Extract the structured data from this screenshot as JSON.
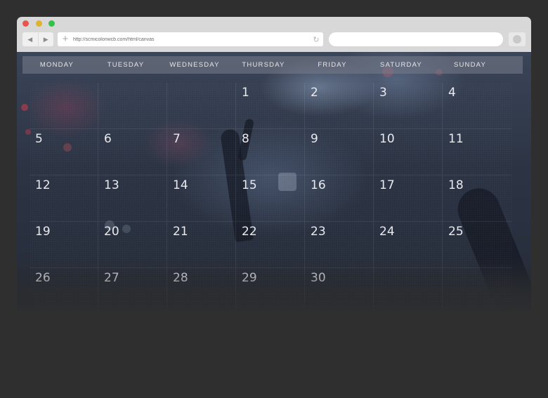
{
  "browser": {
    "url": "http://scmicolonwcb.com/html/canvas",
    "back_icon": "◀",
    "forward_icon": "▶",
    "add_icon": "+",
    "reload_icon": "↻"
  },
  "calendar": {
    "weekdays": [
      "MONDAY",
      "TUESDAY",
      "WEDNESDAY",
      "THURSDAY",
      "FRIDAY",
      "SATURDAY",
      "SUNDAY"
    ],
    "first_weekday_index": 3,
    "days": [
      "1",
      "2",
      "3",
      "4",
      "5",
      "6",
      "7",
      "8",
      "9",
      "10",
      "11",
      "12",
      "13",
      "14",
      "15",
      "16",
      "17",
      "18",
      "19",
      "20",
      "21",
      "22",
      "23",
      "24",
      "25",
      "26",
      "27",
      "28",
      "29",
      "30"
    ]
  },
  "colors": {
    "page_background": "#2f2f2f",
    "chrome": "#d8d8d8",
    "close_dot": "#e8554e",
    "minimize_dot": "#e0b32c",
    "zoom_dot": "#32c246",
    "day_text": "#e9eaee"
  }
}
